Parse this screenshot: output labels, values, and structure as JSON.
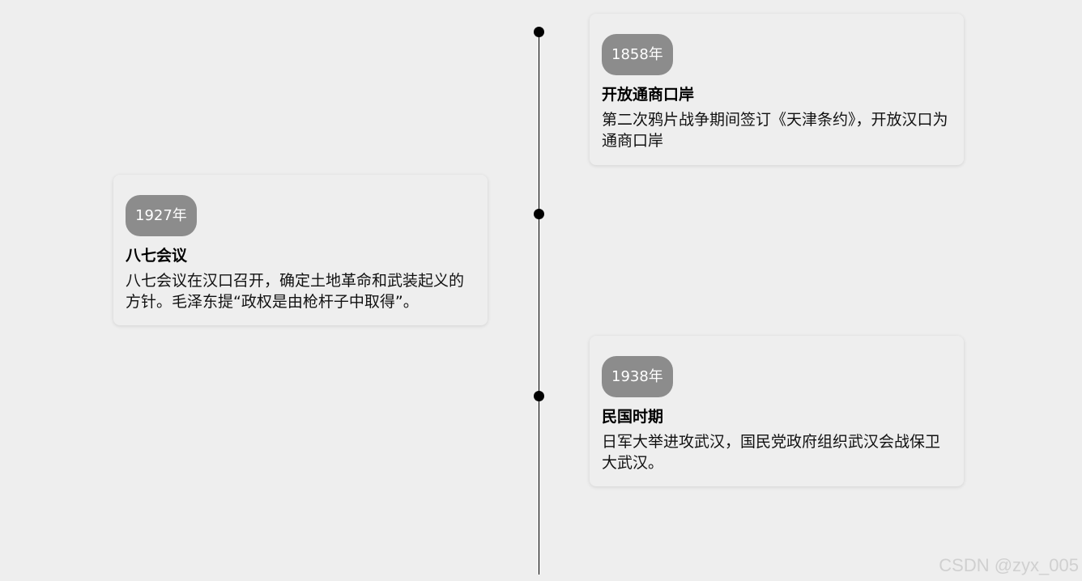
{
  "timeline": {
    "events": [
      {
        "year": "1858年",
        "title": "开放通商口岸",
        "description": "第二次鸦片战争期间签订《天津条约》，开放汉口为通商口岸"
      },
      {
        "year": "1927年",
        "title": "八七会议",
        "description": "八七会议在汉口召开，确定土地革命和武装起义的方针。毛泽东提“政权是由枪杆子中取得”。"
      },
      {
        "year": "1938年",
        "title": "民国时期",
        "description": "日军大举进攻武汉，国民党政府组织武汉会战保卫大武汉。"
      }
    ]
  },
  "watermark": "CSDN @zyx_005",
  "colors": {
    "background": "#eeeeee",
    "badge": "#8c8c8c",
    "line": "#000000"
  }
}
